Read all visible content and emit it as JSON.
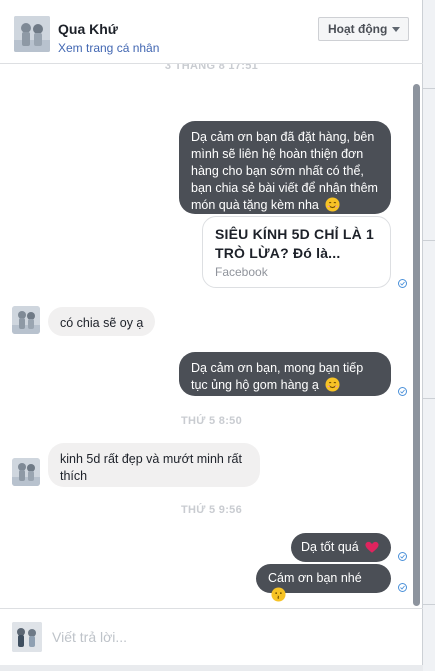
{
  "header": {
    "title": "Qua Khứ",
    "subtitle": "Xem trang cá nhân",
    "status_button": "Hoạt động"
  },
  "thread": {
    "timestamp_top": "3 THÁNG 8 17:51",
    "messages": [
      {
        "from": "page",
        "text": "Dạ cảm ơn bạn đã đặt hàng, bên mình sẽ liên hệ hoàn thiện đơn hàng cho bạn sớm nhất có thể, bạn chia sẻ bài viết để nhận thêm món quà tặng kèm nha",
        "emoji": "smile"
      },
      {
        "from": "page",
        "type": "link",
        "title": "SIÊU KÍNH 5D CHỈ LÀ 1 TRÒ LỪA? Đó là...",
        "source": "Facebook"
      },
      {
        "from": "customer",
        "text": "có chia sẽ oy ạ"
      },
      {
        "from": "page",
        "text": "Dạ cảm ơn bạn, mong bạn tiếp tục ủng hộ gom hàng ạ",
        "emoji": "smile"
      },
      {
        "from": "customer",
        "text": "kinh 5d rất đẹp và mướt minh rất thích"
      },
      {
        "from": "page",
        "text": "Dạ tốt quá",
        "emoji": "heart"
      },
      {
        "from": "page",
        "text": "Cám ơn bạn nhé",
        "emoji": "kiss"
      }
    ],
    "timestamp_mid": "THỨ 5 8:50",
    "timestamp_low": "THỨ 5 9:56"
  },
  "composer": {
    "placeholder": "Viết trả lời..."
  },
  "colors": {
    "outgoing_bubble": "#4b4f56",
    "incoming_bubble": "#f1f0f0",
    "link": "#4267b2",
    "seen_tick": "#4a90d9"
  },
  "icons": [
    "caret-down-icon",
    "seen-check-icon",
    "smile-emoji-icon",
    "heart-emoji-icon",
    "kiss-emoji-icon"
  ]
}
